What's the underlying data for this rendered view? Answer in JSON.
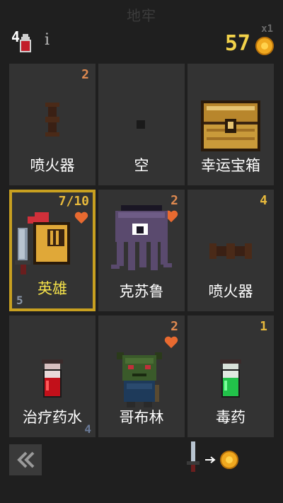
{
  "header": {
    "title": "地牢",
    "potion_count": "4",
    "info_label": "i",
    "gold_multiplier": "x1",
    "gold": "57"
  },
  "cards": [
    {
      "name": "喷火器",
      "number": "2",
      "icon": "flamethrower-icon"
    },
    {
      "name": "空",
      "number": "",
      "icon": "empty-slot-icon"
    },
    {
      "name": "幸运宝箱",
      "number": "",
      "icon": "treasure-chest-icon"
    },
    {
      "name": "英雄",
      "number": "7/10",
      "level": "5",
      "icon": "hero-knight-icon",
      "selected": true
    },
    {
      "name": "克苏鲁",
      "number": "2",
      "icon": "cthulhu-icon"
    },
    {
      "name": "喷火器",
      "number": "4",
      "icon": "flamethrower-icon"
    },
    {
      "name": "治疗药水",
      "number": "",
      "level": "4",
      "icon": "healing-potion-icon"
    },
    {
      "name": "哥布林",
      "number": "2",
      "icon": "goblin-icon"
    },
    {
      "name": "毒药",
      "number": "1",
      "icon": "poison-icon"
    }
  ],
  "footer": {
    "back_icon": "double-chevron-left-icon",
    "trade_icon": "sword-to-coin-icon"
  },
  "colors": {
    "background": "#1f1f1f",
    "card": "#333333",
    "selected_border": "#c8a020",
    "gold": "#f2d24a",
    "damage": "#e08a50"
  }
}
